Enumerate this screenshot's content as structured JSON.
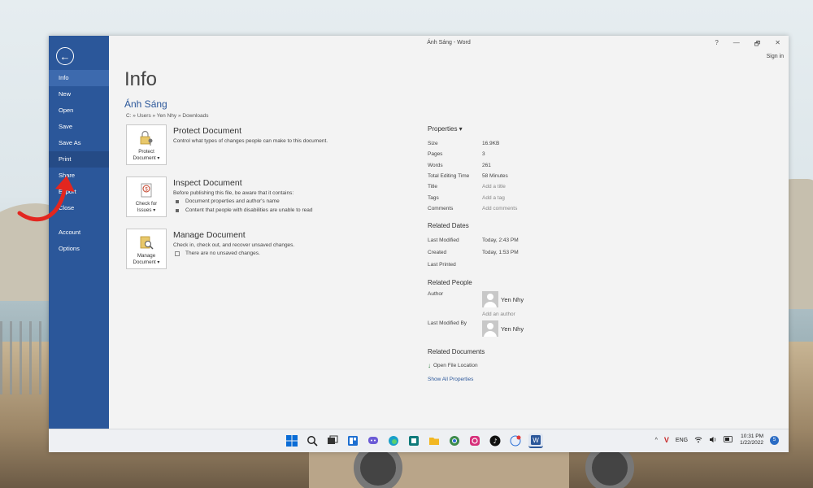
{
  "window": {
    "title": "Ánh Sáng - Word",
    "help": "?",
    "minimize": "—",
    "restore": "🗗",
    "close": "✕",
    "sign_in": "Sign in"
  },
  "sidebar": {
    "back": "←",
    "items": [
      {
        "label": "Info"
      },
      {
        "label": "New"
      },
      {
        "label": "Open"
      },
      {
        "label": "Save"
      },
      {
        "label": "Save As"
      },
      {
        "label": "Print"
      },
      {
        "label": "Share"
      },
      {
        "label": "Export"
      },
      {
        "label": "Close"
      },
      {
        "label": "Account"
      },
      {
        "label": "Options"
      }
    ]
  },
  "info": {
    "title": "Info",
    "doc_name": "Ánh Sáng",
    "doc_path": "C: » Users » Yen Nhy » Downloads",
    "protect": {
      "button": "Protect Document",
      "button_l1": "Protect",
      "button_l2": "Document ▾",
      "title": "Protect Document",
      "desc": "Control what types of changes people can make to this document."
    },
    "inspect": {
      "button_l1": "Check for",
      "button_l2": "Issues ▾",
      "title": "Inspect Document",
      "desc": "Before publishing this file, be aware that it contains:",
      "items": [
        "Document properties and author's name",
        "Content that people with disabilities are unable to read"
      ]
    },
    "manage": {
      "button_l1": "Manage",
      "button_l2": "Document ▾",
      "title": "Manage Document",
      "desc": "Check in, check out, and recover unsaved changes.",
      "note": "There are no unsaved changes."
    }
  },
  "properties": {
    "header": "Properties ▾",
    "rows": [
      {
        "key": "Size",
        "value": "16.9KB"
      },
      {
        "key": "Pages",
        "value": "3"
      },
      {
        "key": "Words",
        "value": "261"
      },
      {
        "key": "Total Editing Time",
        "value": "58 Minutes"
      },
      {
        "key": "Title",
        "value": "Add a title"
      },
      {
        "key": "Tags",
        "value": "Add a tag"
      },
      {
        "key": "Comments",
        "value": "Add comments"
      }
    ],
    "dates_head": "Related Dates",
    "dates": [
      {
        "key": "Last Modified",
        "value": "Today, 2:43 PM"
      },
      {
        "key": "Created",
        "value": "Today, 1:53 PM"
      },
      {
        "key": "Last Printed",
        "value": ""
      }
    ],
    "people_head": "Related People",
    "author_key": "Author",
    "author_name": "Yen Nhy",
    "add_author": "Add an author",
    "lastmod_key": "Last Modified By",
    "lastmod_name": "Yen Nhy",
    "docs_head": "Related Documents",
    "open_location": "Open File Location",
    "show_all": "Show All Properties"
  },
  "taskbar": {
    "tray_up": "^",
    "lang": "ENG",
    "time": "10:31 PM",
    "date": "1/22/2022",
    "notif": "5"
  }
}
